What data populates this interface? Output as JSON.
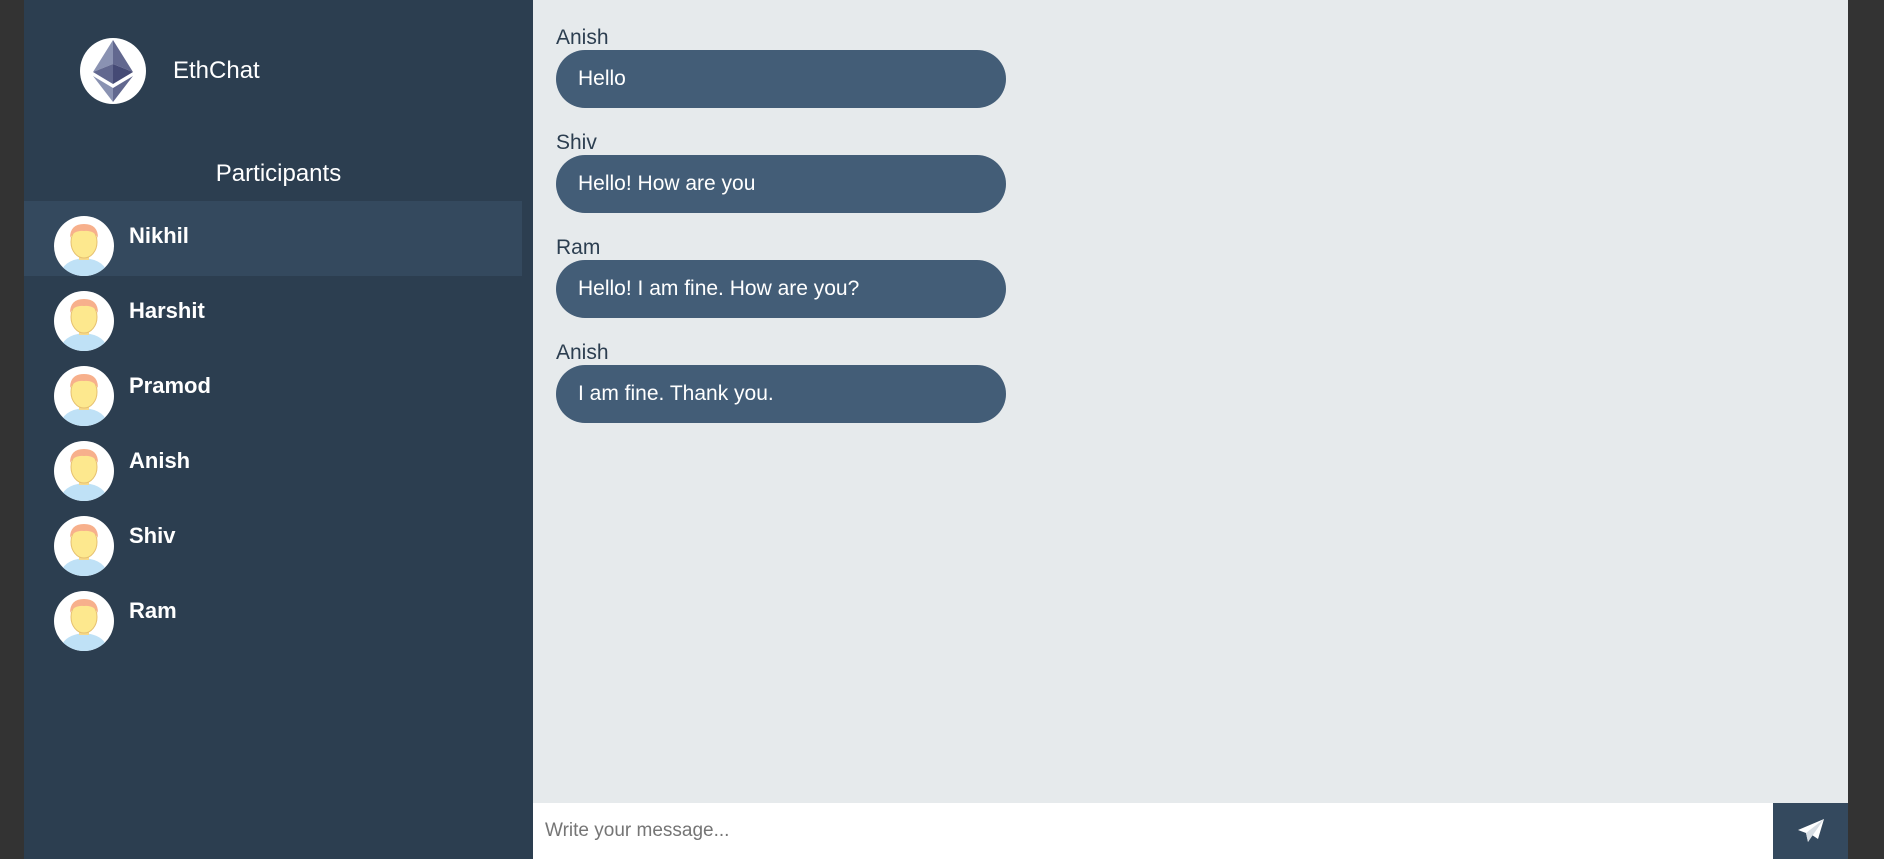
{
  "app": {
    "name": "EthChat",
    "logo_icon": "ethereum-logo-icon"
  },
  "sidebar": {
    "title": "Participants",
    "participants": [
      {
        "name": "Nikhil",
        "active": true
      },
      {
        "name": "Harshit"
      },
      {
        "name": "Pramod"
      },
      {
        "name": "Anish"
      },
      {
        "name": "Shiv"
      },
      {
        "name": "Ram"
      }
    ]
  },
  "messages": [
    {
      "sender": "Anish",
      "text": "Hello"
    },
    {
      "sender": "Shiv",
      "text": "Hello! How are you"
    },
    {
      "sender": "Ram",
      "text": "Hello! I am fine. How are you?"
    },
    {
      "sender": "Anish",
      "text": "I am fine. Thank you."
    }
  ],
  "composer": {
    "placeholder": "Write your message...",
    "send_icon": "paper-plane-icon"
  },
  "colors": {
    "sidebar": "#2c3e50",
    "active_row": "#34495e",
    "bubble": "#435d77",
    "chat_bg": "#e6eaec"
  }
}
